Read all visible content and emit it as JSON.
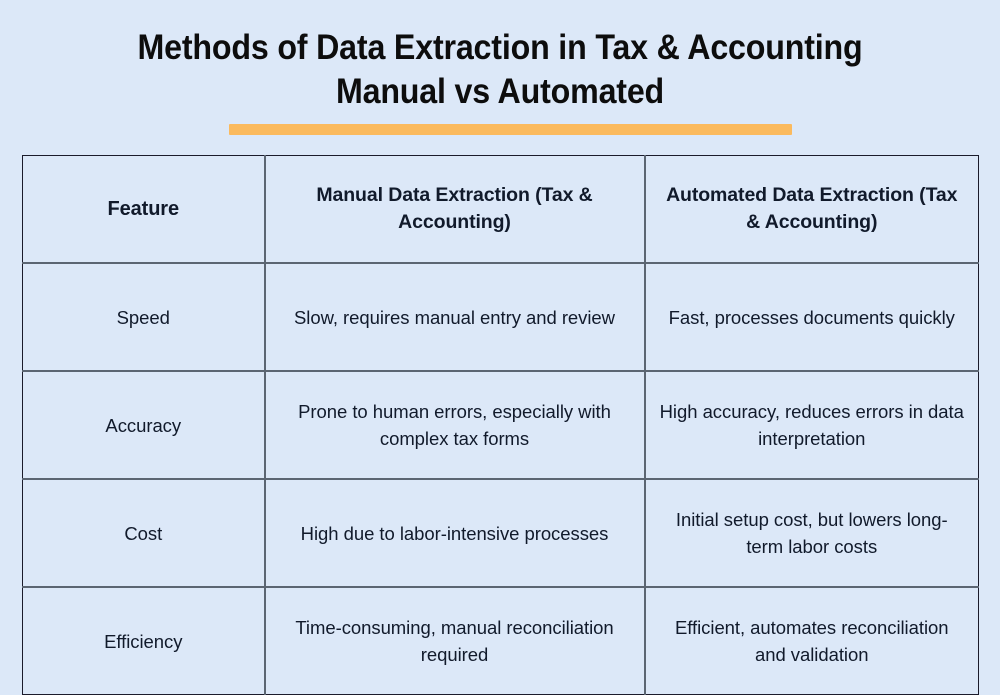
{
  "theme": {
    "background_color": "#dce8f8",
    "accent_color": "#fbba5e",
    "text_color": "#111a2b",
    "title_color": "#0d0d0d",
    "table_outer_border_color": "#1b1b2b",
    "table_inner_border_color": "#5b6572"
  },
  "title": {
    "line1": "Methods of Data Extraction in Tax & Accounting",
    "line2": "Manual vs Automated"
  },
  "table": {
    "headers": [
      "Feature",
      "Manual Data Extraction (Tax & Accounting)",
      "Automated Data Extraction (Tax & Accounting)"
    ],
    "rows": [
      {
        "feature": "Speed",
        "manual": "Slow, requires manual entry and review",
        "automated": "Fast, processes documents quickly"
      },
      {
        "feature": "Accuracy",
        "manual": "Prone to human errors, especially with complex tax forms",
        "automated": "High accuracy, reduces errors in data interpretation"
      },
      {
        "feature": "Cost",
        "manual": "High due to labor-intensive processes",
        "automated": "Initial setup cost, but lowers long-term labor costs"
      },
      {
        "feature": "Efficiency",
        "manual": "Time-consuming, manual reconciliation required",
        "automated": "Efficient, automates reconciliation and validation"
      }
    ]
  }
}
